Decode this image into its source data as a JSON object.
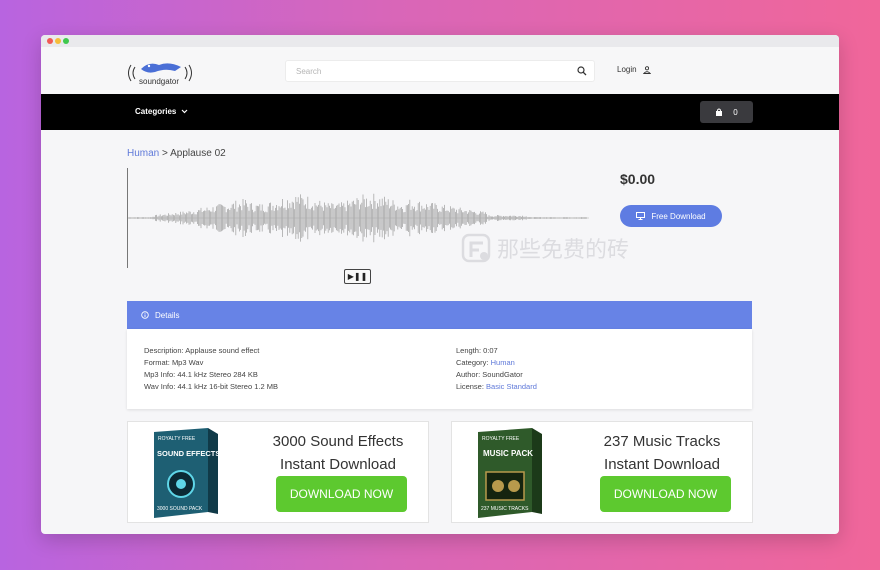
{
  "logo": {
    "text": "soundgator"
  },
  "search": {
    "placeholder": "Search"
  },
  "header": {
    "login_label": "Login"
  },
  "nav": {
    "categories_label": "Categories",
    "cart_count": "0"
  },
  "breadcrumb": {
    "parent": "Human",
    "separator": ">",
    "current": "Applause 02"
  },
  "product": {
    "price": "$0.00",
    "download_label": "Free Download"
  },
  "player": {
    "play_pause_symbol": "▶❚❚"
  },
  "watermark": {
    "text": "那些免费的砖"
  },
  "details": {
    "tab_label": "Details",
    "left": [
      {
        "label": "Description:",
        "value": "Applause sound effect"
      },
      {
        "label": "Format:",
        "value": "Mp3 Wav"
      },
      {
        "label": "Mp3 Info:",
        "value": "44.1 kHz Stereo 284 KB"
      },
      {
        "label": "Wav Info:",
        "value": "44.1 kHz 16-bit Stereo 1.2 MB"
      }
    ],
    "right": [
      {
        "label": "Length:",
        "value": "0:07"
      },
      {
        "label": "Category:",
        "value": "Human"
      },
      {
        "label": "Author:",
        "value": "SoundGator"
      },
      {
        "label": "License:",
        "value": "Basic Standard"
      }
    ]
  },
  "ads": [
    {
      "title_line1": "3000 Sound Effects",
      "title_line2": "Instant Download",
      "button": "DOWNLOAD NOW",
      "box_top": "ROYALTY FREE",
      "box_main": "SOUND EFFECTS",
      "box_bottom": "3000 SOUND PACK"
    },
    {
      "title_line1": "237 Music Tracks",
      "title_line2": "Instant Download",
      "button": "DOWNLOAD NOW",
      "box_top": "ROYALTY FREE",
      "box_main": "MUSIC PACK",
      "box_bottom": "237 MUSIC TRACKS"
    }
  ],
  "colors": {
    "accent": "#5e7ce2",
    "details_bar": "#6783e6",
    "cta_green": "#5dc92f",
    "navbar": "#000000"
  }
}
